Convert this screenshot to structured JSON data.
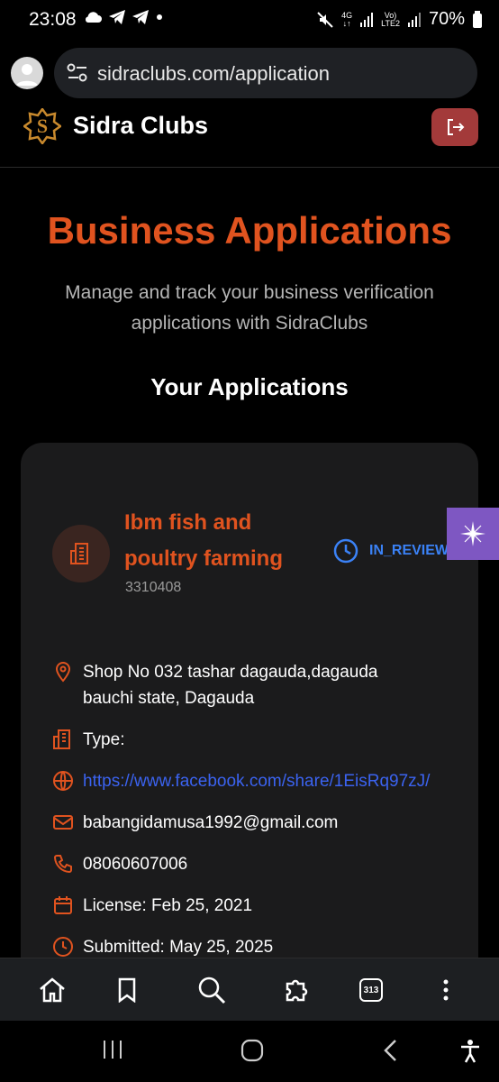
{
  "status_bar": {
    "time": "23:08",
    "network_label_top": "4G",
    "volte_label_top": "Vo)",
    "volte_label_bottom": "LTE2",
    "battery": "70%"
  },
  "browser": {
    "url": "sidraclubs.com/application",
    "tab_count": "313"
  },
  "site": {
    "brand": "Sidra Clubs",
    "logo_letter": "S"
  },
  "page": {
    "title": "Business Applications",
    "subtitle": "Manage and track your business verification applications with SidraClubs",
    "section_title": "Your Applications"
  },
  "application": {
    "name": "Ibm fish and poultry farming",
    "id": "3310408",
    "status": "IN_REVIEW",
    "address": "Shop No 032 tashar dagauda,dagauda bauchi state, Dagauda",
    "type": "Type:",
    "website": "https://www.facebook.com/share/1EisRq97zJ/",
    "email": "babangidamusa1992@gmail.com",
    "phone": "08060607006",
    "license": "License: Feb 25, 2021",
    "submitted": "Submitted: May 25, 2025"
  },
  "colors": {
    "accent": "#e0531f",
    "status_blue": "#3b82f6",
    "link": "#3b63f0",
    "logout_bg": "#a33a3a",
    "card_bg": "#1b1b1c",
    "floating_button": "#7e57c2"
  }
}
